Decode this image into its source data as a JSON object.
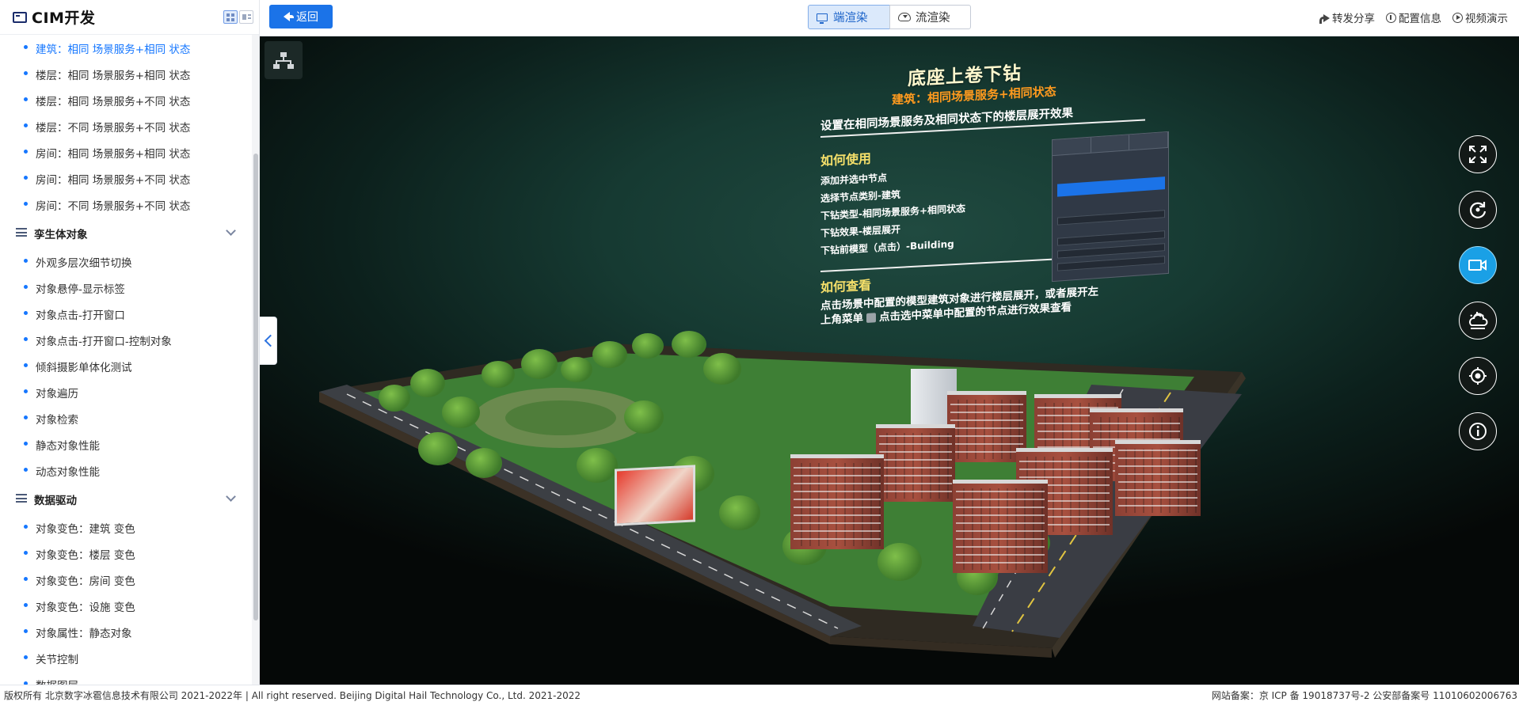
{
  "sidebar": {
    "title": "CIM开发",
    "items": [
      {
        "label": "建筑：相同 场景服务+相同 状态",
        "active": true
      },
      {
        "label": "楼层：相同 场景服务+相同 状态"
      },
      {
        "label": "楼层：相同 场景服务+不同 状态"
      },
      {
        "label": "楼层：不同 场景服务+不同 状态"
      },
      {
        "label": "房间：相同 场景服务+相同 状态"
      },
      {
        "label": "房间：相同 场景服务+不同 状态"
      },
      {
        "label": "房间：不同 场景服务+不同 状态"
      }
    ],
    "section_twin": {
      "label": "孪生体对象",
      "items": [
        {
          "label": "外观多层次细节切换"
        },
        {
          "label": "对象悬停-显示标签"
        },
        {
          "label": "对象点击-打开窗口"
        },
        {
          "label": "对象点击-打开窗口-控制对象"
        },
        {
          "label": "倾斜摄影单体化测试"
        },
        {
          "label": "对象遍历"
        },
        {
          "label": "对象检索"
        },
        {
          "label": "静态对象性能"
        },
        {
          "label": "动态对象性能"
        }
      ]
    },
    "section_data": {
      "label": "数据驱动",
      "items": [
        {
          "label": "对象变色：建筑 变色"
        },
        {
          "label": "对象变色：楼层 变色"
        },
        {
          "label": "对象变色：房间 变色"
        },
        {
          "label": "对象变色：设施 变色"
        },
        {
          "label": "对象属性：静态对象"
        },
        {
          "label": "关节控制"
        },
        {
          "label": "数据图层"
        }
      ]
    }
  },
  "topbar": {
    "back_label": "返回",
    "render_device_label": "端渲染",
    "render_cloud_label": "流渲染",
    "render_mode_selected": "端渲染",
    "links": {
      "share": "转发分享",
      "config": "配置信息",
      "video": "视频演示"
    }
  },
  "viewport": {
    "panel": {
      "title": "底座上卷下钻",
      "subtitle": "建筑：相同场景服务+相同状态",
      "description": "设置在相同场景服务及相同状态下的楼层展开效果",
      "how_to_use": "如何使用",
      "steps": [
        "添加并选中节点",
        "选择节点类别-建筑",
        "下钻类型-相同场景服务+相同状态",
        "下钻效果-楼层展开",
        "下钻前模型（点击）-Building"
      ],
      "how_to_view": "如何查看",
      "view_line1": "点击场景中配置的模型建筑对象进行楼层展开，或者展开左",
      "view_line2_a": "上角菜单",
      "view_line2_b": "点击选中菜单中配置的节点进行效果查看"
    },
    "tools": [
      {
        "icon": "fullscreen-icon"
      },
      {
        "icon": "refresh-icon"
      },
      {
        "icon": "camera-icon",
        "active": true
      },
      {
        "icon": "weather-icon"
      },
      {
        "icon": "location-icon"
      },
      {
        "icon": "info-icon"
      }
    ]
  },
  "footer": {
    "copyright": "版权所有 北京数字冰雹信息技术有限公司 2021-2022年 | All right reserved. Beijing Digital Hail Technology Co., Ltd. 2021-2022",
    "icp": "网站备案：京 ICP 备 19018737号-2 公安部备案号 11010602006763"
  },
  "colors": {
    "primary": "#1b73e8",
    "active_item": "#1677ff",
    "panel_title": "#fff8ce",
    "panel_subtitle": "#ff9a1e",
    "panel_heading": "#f6e06a",
    "tool_active": "#1aa0e6"
  }
}
